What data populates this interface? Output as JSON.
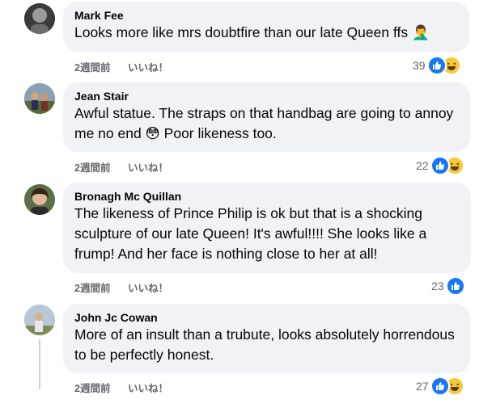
{
  "comments": [
    {
      "author": "Mark Fee",
      "text": "Looks more like mrs doubtfire than our late Queen ffs 🤦‍♂️",
      "time": "2週間前",
      "like_label": "いいね！",
      "reaction_count": "39",
      "reactions": [
        "like",
        "haha"
      ]
    },
    {
      "author": "Jean Stair",
      "text": "Awful statue. The straps on that handbag are going to annoy me no end 😳 Poor likeness too.",
      "time": "2週間前",
      "like_label": "いいね！",
      "reaction_count": "22",
      "reactions": [
        "like",
        "haha"
      ]
    },
    {
      "author": "Bronagh Mc Quillan",
      "text": "The likeness of Prince Philip is ok but that is a shocking sculpture of our late Queen! It's awful!!!! She looks like a frump! And her face is nothing close to her at all!",
      "time": "2週間前",
      "like_label": "いいね！",
      "reaction_count": "23",
      "reactions": [
        "like"
      ]
    },
    {
      "author": "John Jc Cowan",
      "text": "More of an insult than a trubute, looks absolutely horrendous to be perfectly honest.",
      "time": "2週間前",
      "like_label": "いいね！",
      "reaction_count": "27",
      "reactions": [
        "like",
        "haha"
      ]
    }
  ],
  "colors": {
    "bubble": "#f0f2f5",
    "like_blue": "#1877f2",
    "haha_yellow": "#f7c93a",
    "meta_gray": "#65676b"
  }
}
